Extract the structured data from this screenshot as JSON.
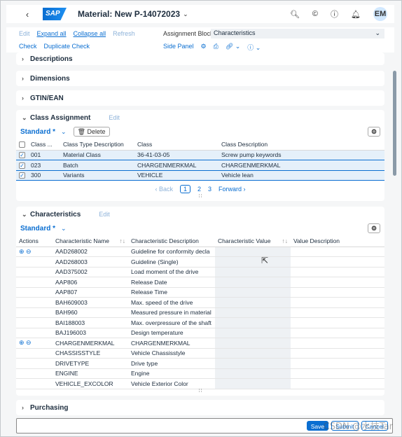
{
  "shell": {
    "back": "‹",
    "logo": "SAP",
    "title": "Material: New P-14072023",
    "title_chevron": "⌄",
    "icons": [
      "search-icon",
      "copyright-icon",
      "help-icon",
      "bell-icon"
    ],
    "avatar": "EM"
  },
  "toolbar": {
    "edit": "Edit",
    "expand_all": "Expand all",
    "collapse_all": "Collapse all",
    "refresh": "Refresh",
    "check": "Check",
    "duplicate_check": "Duplicate Check",
    "assignment_block_label": "Assignment Block:",
    "assignment_block_value": "Characteristics",
    "side_panel": "Side Panel"
  },
  "sections": {
    "descriptions": "Descriptions",
    "dimensions": "Dimensions",
    "gtin": "GTIN/EAN",
    "purchasing": "Purchasing"
  },
  "class_assignment": {
    "title": "Class Assignment",
    "edit": "Edit",
    "variant": "Standard *",
    "delete": "Delete",
    "columns": [
      "Class ...",
      "Class Type Description",
      "Class",
      "Class Description"
    ],
    "rows": [
      {
        "type": "001",
        "desc": "Material Class",
        "class": "36-41-03-05",
        "class_desc": "Screw pump keywords"
      },
      {
        "type": "023",
        "desc": "Batch",
        "class": "CHARGENMERKMAL",
        "class_desc": "CHARGENMERKMAL"
      },
      {
        "type": "300",
        "desc": "Variants",
        "class": "VEHICLE",
        "class_desc": "Vehicle lean"
      }
    ],
    "pager": {
      "back": "‹ Back",
      "pages": [
        "1",
        "2",
        "3"
      ],
      "forward": "Forward ›"
    }
  },
  "characteristics": {
    "title": "Characteristics",
    "edit": "Edit",
    "variant": "Standard *",
    "columns": [
      "Actions",
      "Characteristic Name",
      "Characteristic Description",
      "Characteristic Value",
      "Value Description"
    ],
    "rows": [
      {
        "actions": "⊕ ⊖",
        "name": "AAD268002",
        "desc": "Guideline for conformity decla"
      },
      {
        "actions": "",
        "name": "AAD268003",
        "desc": "Guideline (Single)"
      },
      {
        "actions": "",
        "name": "AAD375002",
        "desc": "Load moment of the drive"
      },
      {
        "actions": "",
        "name": "AAP806",
        "desc": "Release Date"
      },
      {
        "actions": "",
        "name": "AAP807",
        "desc": "Release Time"
      },
      {
        "actions": "",
        "name": "BAH609003",
        "desc": "Max. speed of the drive"
      },
      {
        "actions": "",
        "name": "BAH960",
        "desc": "Measured pressure in material"
      },
      {
        "actions": "",
        "name": "BAI188003",
        "desc": "Max. overpressure of the shaft"
      },
      {
        "actions": "",
        "name": "BAJ196003",
        "desc": "Design temperature"
      },
      {
        "actions": "⊕ ⊖",
        "name": "CHARGENMERKMAL",
        "desc": "CHARGENMERKMAL"
      },
      {
        "actions": "",
        "name": "CHASSISSTYLE",
        "desc": "Vehicle Chassisstyle"
      },
      {
        "actions": "",
        "name": "DRIVETYPE",
        "desc": "Drive type"
      },
      {
        "actions": "",
        "name": "ENGINE",
        "desc": "Engine"
      },
      {
        "actions": "",
        "name": "VEHICLE_EXCOLOR",
        "desc": "Vehicle Exterior Color"
      }
    ]
  },
  "footer": {
    "save": "Save",
    "submit": "Submit",
    "cancel": "Cancel"
  },
  "watermark": "CSDN @水技Tar"
}
